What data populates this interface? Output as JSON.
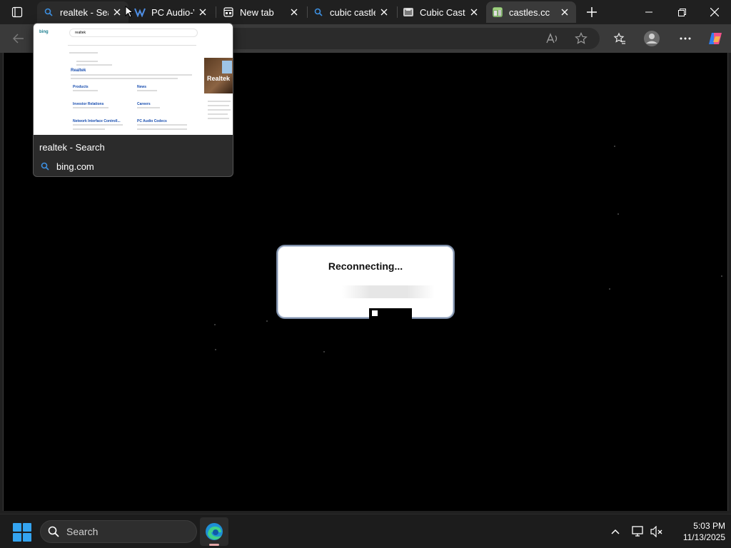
{
  "browser": {
    "tabs": [
      {
        "title": "realtek - Sea",
        "favicon": "search-icon"
      },
      {
        "title": "PC Audio-V",
        "favicon": "realtek-icon"
      },
      {
        "title": "New tab",
        "favicon": "newtab-icon"
      },
      {
        "title": "cubic castle",
        "favicon": "search-icon"
      },
      {
        "title": "Cubic Castle",
        "favicon": "cubic-castles-icon"
      },
      {
        "title": "castles.cc",
        "favicon": "castles-icon"
      }
    ],
    "active_tab_index": 5
  },
  "hover_card": {
    "title": "realtek - Search",
    "domain": "bing.com",
    "thumbnail": {
      "brand": "bing",
      "query": "realtek",
      "result_title": "Realtek",
      "side_logo_word": "Realtek",
      "sitelinks": [
        "Products",
        "News",
        "Investor Relations",
        "Careers",
        "Network Interface Controll...",
        "PC Audio Codecs"
      ]
    }
  },
  "game": {
    "dialog_text": "Reconnecting...",
    "progress": 0.15
  },
  "taskbar": {
    "search_label": "Search",
    "time": "5:03 PM",
    "date": "11/13/2025"
  },
  "colors": {
    "accent": "#34a4f0",
    "chrome_bg": "#202020",
    "toolbar_bg": "#3a3a3a",
    "viewport_bg": "#000000"
  }
}
